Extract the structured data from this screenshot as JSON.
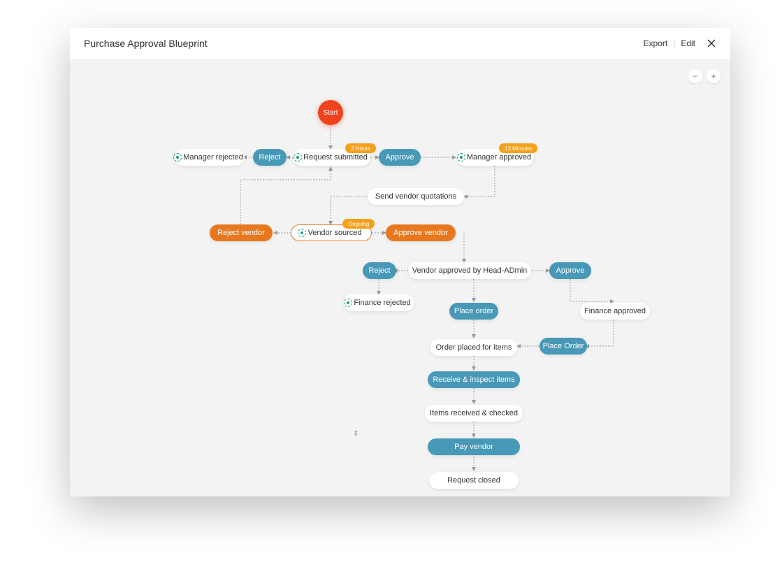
{
  "header": {
    "title": "Purchase Approval Blueprint",
    "export": "Export",
    "edit": "Edit"
  },
  "zoom": {
    "minus": "−",
    "plus": "+"
  },
  "nodes": {
    "start": "Start",
    "manager_rejected": "Manager rejected",
    "reject1": "Reject",
    "request_submitted": "Request submitted",
    "approve1": "Approve",
    "manager_approved": "Manager approved",
    "send_vendor": "Send vendor quotations",
    "reject_vendor": "Reject vendor",
    "vendor_sourced": "Vendor sourced",
    "approve_vendor": "Approve vendor",
    "reject2": "Reject",
    "vendor_head": "Vendor approved by Head-ADmin",
    "approve2": "Approve",
    "finance_rejected": "Finance rejected",
    "place_order": "Place order",
    "finance_approved": "Finance approved",
    "order_placed": "Order placed for items",
    "place_order2": "Place Order",
    "receive_inspect": "Receive & inspect items",
    "items_received": "Items received & checked",
    "pay_vendor": "Pay vendor",
    "request_closed": "Request closed"
  },
  "badges": {
    "two_hours": "2 Hours",
    "thirteen_min": "13 Minutes",
    "ongoing": "Ongoing"
  }
}
